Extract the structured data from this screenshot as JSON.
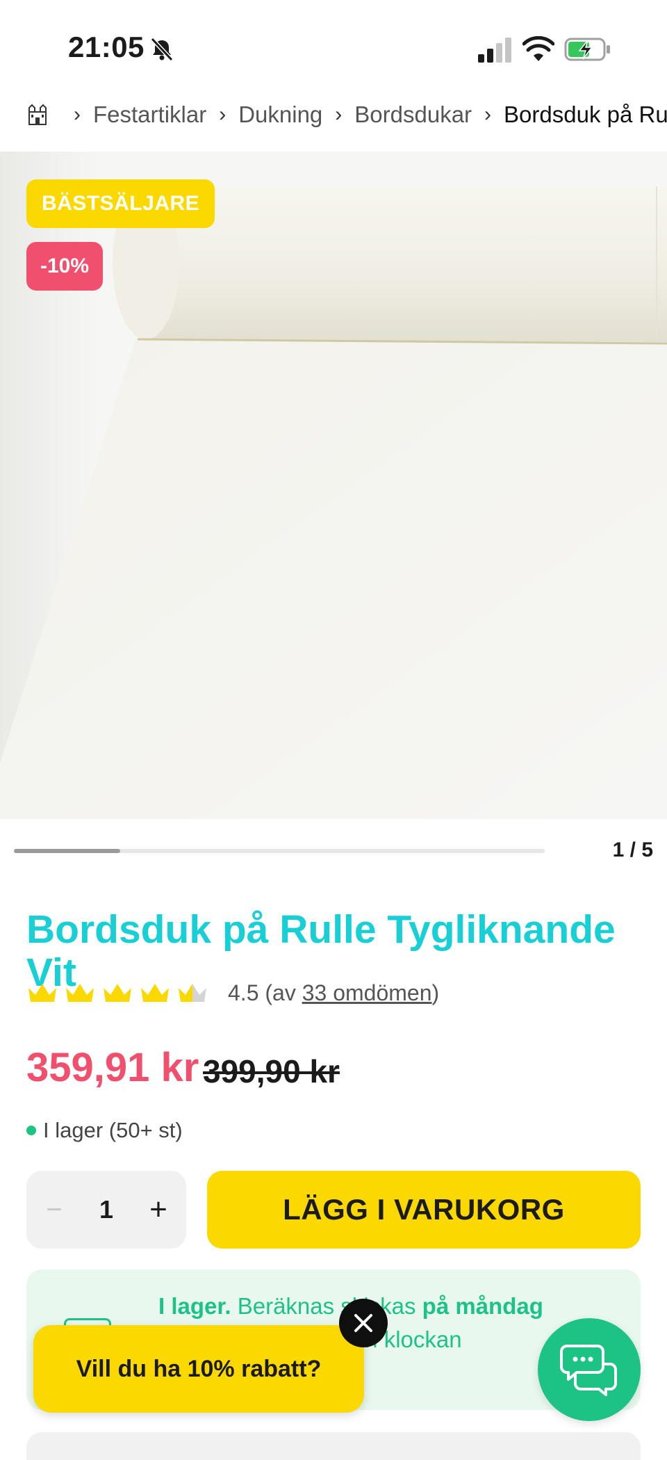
{
  "status_bar": {
    "time": "21:05",
    "icons": [
      "bell-slash-icon",
      "cellular-signal-icon",
      "wifi-icon",
      "battery-charging-icon"
    ]
  },
  "breadcrumb": {
    "home_icon": "castle-icon",
    "items": [
      "Festartiklar",
      "Dukning",
      "Bordsdukar"
    ],
    "current": "Bordsduk på Rulle Tygliknande Vit"
  },
  "gallery": {
    "badges": {
      "bestseller": "BÄSTSÄLJARE",
      "discount": "-10%"
    },
    "counter": "1 / 5",
    "progress": 0.2
  },
  "product": {
    "title": "Bordsduk på Rulle Tygliknande Vit",
    "rating": {
      "value": 4.5,
      "value_label": "4.5",
      "prefix": "(av ",
      "reviews_link": "33 omdömen",
      "suffix": ")"
    },
    "price": {
      "current": "359,91 kr",
      "original": "399,90 kr"
    },
    "stock": "I lager (50+ st)"
  },
  "purchase": {
    "quantity": "1",
    "minus": "−",
    "plus": "+",
    "add_to_cart": "LÄGG I VARUKORG"
  },
  "delivery": {
    "line1_bold": "I lager.",
    "line1_text": " Beräknas skickas ",
    "line1_bold2": "på måndag",
    "line2": "om du beställer innan klockan",
    "line3": "...)"
  },
  "promo": {
    "text": "Vill du ha 10% rabatt?"
  },
  "colors": {
    "accent_cyan": "#19cfd6",
    "price_red": "#f0506e",
    "yellow": "#fbd900",
    "green": "#1dc285"
  }
}
